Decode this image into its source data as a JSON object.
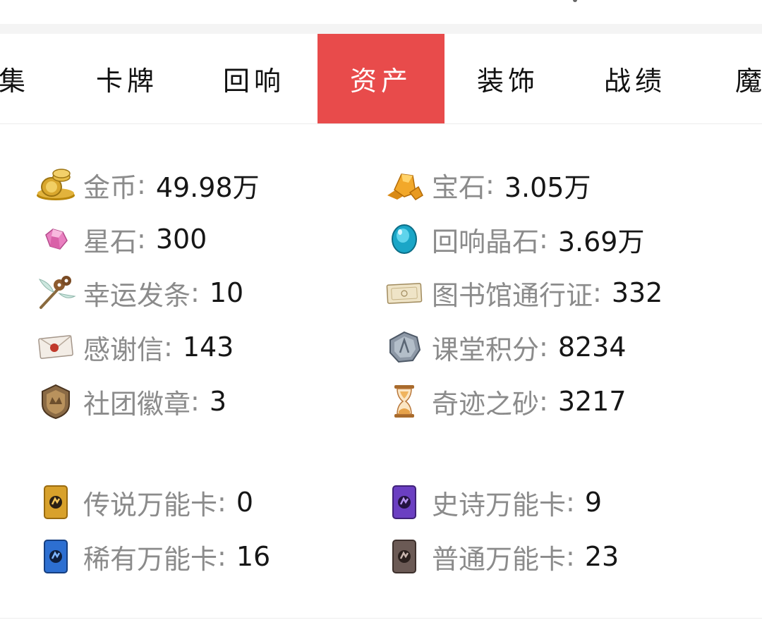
{
  "tabs": [
    {
      "label": "集"
    },
    {
      "label": "卡牌"
    },
    {
      "label": "回响"
    },
    {
      "label": "资产",
      "active": true
    },
    {
      "label": "装饰"
    },
    {
      "label": "战绩"
    },
    {
      "label": "魔"
    }
  ],
  "assets": {
    "separator": ":",
    "items": [
      {
        "label": "金币",
        "value": "49.98万",
        "icon": "gold-coins-icon"
      },
      {
        "label": "宝石",
        "value": "3.05万",
        "icon": "gem-icon"
      },
      {
        "label": "星石",
        "value": "300",
        "icon": "star-stone-icon"
      },
      {
        "label": "回响晶石",
        "value": "3.69万",
        "icon": "echo-crystal-icon"
      },
      {
        "label": "幸运发条",
        "value": "10",
        "icon": "lucky-windup-key-icon"
      },
      {
        "label": "图书馆通行证",
        "value": "332",
        "icon": "library-pass-icon"
      },
      {
        "label": "感谢信",
        "value": "143",
        "icon": "thank-you-letter-icon"
      },
      {
        "label": "课堂积分",
        "value": "8234",
        "icon": "class-points-coin-icon"
      },
      {
        "label": "社团徽章",
        "value": "3",
        "icon": "club-badge-icon"
      },
      {
        "label": "奇迹之砂",
        "value": "3217",
        "icon": "hourglass-sand-icon"
      }
    ],
    "cards": [
      {
        "label": "传说万能卡",
        "value": "0",
        "icon": "legendary-wildcard-icon",
        "color": "#d8a12b"
      },
      {
        "label": "史诗万能卡",
        "value": "9",
        "icon": "epic-wildcard-icon",
        "color": "#6b3fc2"
      },
      {
        "label": "稀有万能卡",
        "value": "16",
        "icon": "rare-wildcard-icon",
        "color": "#2d6fd1"
      },
      {
        "label": "普通万能卡",
        "value": "23",
        "icon": "common-wildcard-icon",
        "color": "#6b5a55"
      }
    ]
  }
}
